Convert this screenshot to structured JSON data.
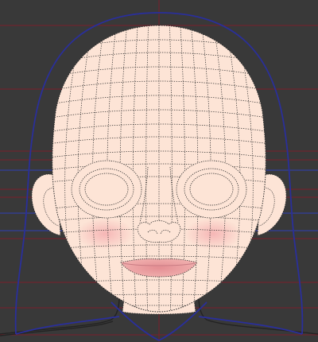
{
  "viewport": {
    "background_color": "#393939",
    "guide_color": "#7a1f2a",
    "guide_blue_color": "#2f3fb8",
    "hair_outline_color": "#2a2f9a",
    "mesh_color": "#2b2b2b",
    "skin_color": "#fde4d6",
    "blush_color": "#f6b7b5",
    "lip_color": "#e79a9a",
    "body_line_color": "#232323"
  }
}
